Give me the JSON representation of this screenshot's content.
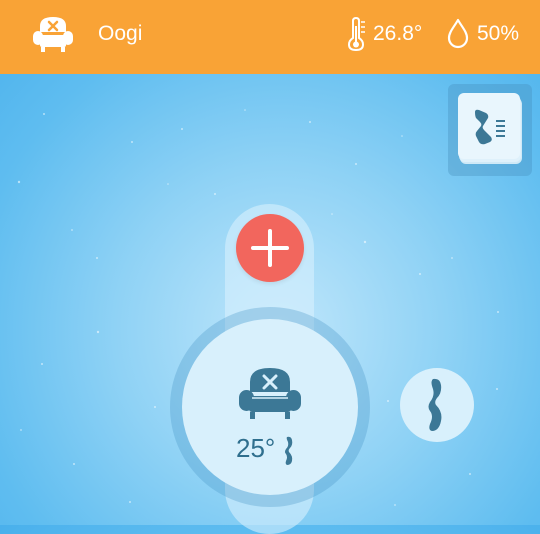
{
  "header": {
    "app_icon": "armchair-icon",
    "app_name": "Oogi",
    "temperature_icon": "thermometer-icon",
    "temperature": "26.8°",
    "humidity_icon": "water-drop-icon",
    "humidity": "50%"
  },
  "scene_button": {
    "icon": "scene-card-icon"
  },
  "control": {
    "add_icon": "plus-icon",
    "mode_icon": "armchair-icon",
    "setpoint": "25°",
    "fan_icon": "fan-blade-icon"
  },
  "colors": {
    "header": "#f9a336",
    "accent_red": "#f2665d",
    "icon_blue": "#3c7896",
    "dial_face": "#d8f0fc",
    "background": "#5fbdf0"
  }
}
